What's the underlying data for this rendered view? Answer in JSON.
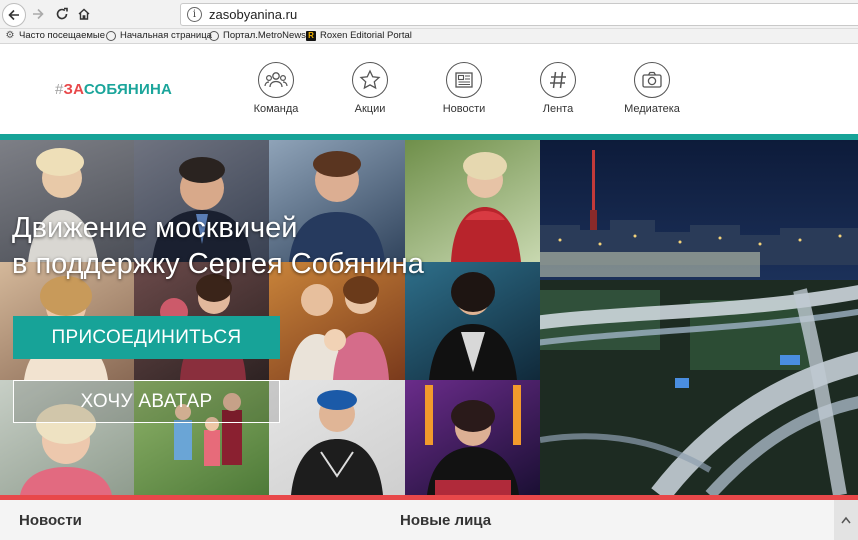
{
  "browser": {
    "url": "zasobyanina.ru",
    "bookmarks": [
      {
        "label": "Часто посещаемые",
        "icon": "gear-icon"
      },
      {
        "label": "Начальная страница",
        "icon": "globe-icon"
      },
      {
        "label": "Портал.MetroNews",
        "icon": "globe-icon"
      },
      {
        "label": "Roxen Editorial Portal",
        "icon": "roxen-icon"
      }
    ]
  },
  "site": {
    "logo": {
      "hash": "#",
      "za": "ЗА",
      "rest": "СОБЯНИНА"
    },
    "nav": [
      {
        "label": "Команда",
        "icon": "team-icon"
      },
      {
        "label": "Акции",
        "icon": "star-icon"
      },
      {
        "label": "Новости",
        "icon": "newspaper-icon"
      },
      {
        "label": "Лента",
        "icon": "hashtag-icon"
      },
      {
        "label": "Медиатека",
        "icon": "camera-icon"
      }
    ]
  },
  "hero": {
    "title_line1": "Движение москвичей",
    "title_line2": "в поддержку Сергея Собянина",
    "join_button": "ПРИСОЕДИНИТЬСЯ",
    "avatar_button": "ХОЧУ АВАТАР"
  },
  "sections": {
    "news": "Новости",
    "new_faces": "Новые лица"
  },
  "colors": {
    "accent": "#17a398",
    "red": "#e8484a"
  }
}
